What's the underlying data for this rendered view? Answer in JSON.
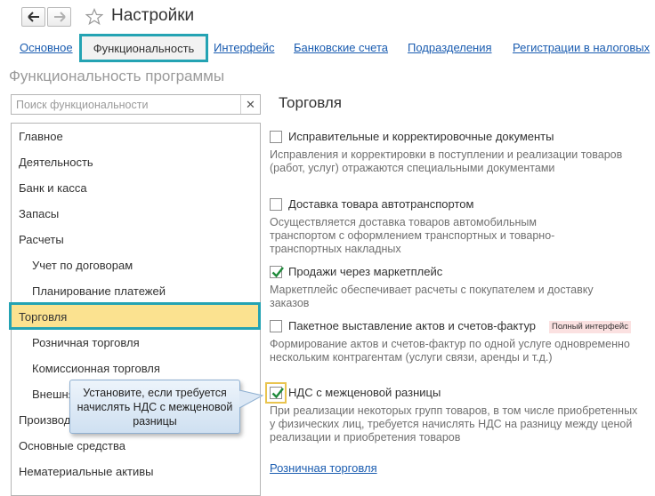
{
  "window": {
    "title": "Настройки"
  },
  "tabs": [
    {
      "label": "Основное"
    },
    {
      "label": "Функциональность",
      "active": true
    },
    {
      "label": "Интерфейс"
    },
    {
      "label": "Банковские счета"
    },
    {
      "label": "Подразделения"
    },
    {
      "label": "Регистрации в налоговых"
    }
  ],
  "section": {
    "title": "Функциональность программы"
  },
  "search": {
    "placeholder": "Поиск функциональности",
    "value": ""
  },
  "categories": [
    {
      "label": "Главное",
      "level": 0
    },
    {
      "label": "Деятельность",
      "level": 0
    },
    {
      "label": "Банк и касса",
      "level": 0
    },
    {
      "label": "Запасы",
      "level": 0
    },
    {
      "label": "Расчеты",
      "level": 0
    },
    {
      "label": "Учет по договорам",
      "level": 1
    },
    {
      "label": "Планирование платежей",
      "level": 1
    },
    {
      "label": "Торговля",
      "level": 0,
      "selected": true
    },
    {
      "label": "Розничная торговля",
      "level": 1
    },
    {
      "label": "Комиссионная торговля",
      "level": 1
    },
    {
      "label": "Внешняя торговля",
      "level": 1
    },
    {
      "label": "Производство",
      "level": 0
    },
    {
      "label": "Основные средства",
      "level": 0
    },
    {
      "label": "Нематериальные активы",
      "level": 0
    }
  ],
  "panel": {
    "title": "Торговля",
    "options": [
      {
        "label": "Исправительные и корректировочные документы",
        "checked": false,
        "description": "Исправления и корректировки в поступлении и реализации товаров (работ, услуг) отражаются специальными документами"
      },
      {
        "label": "Доставка товара автотранспортом",
        "checked": false,
        "description": "Осуществляется доставка товаров автомобильным транспортом с оформлением транспортных и товарно-транспортных накладных"
      },
      {
        "label": "Продажи через маркетплейс",
        "checked": true,
        "description": "Маркетплейс обеспечивает расчеты с покупателем и доставку заказов"
      },
      {
        "label": "Пакетное выставление актов и счетов-фактур",
        "checked": false,
        "badge": "Полный интерфейс",
        "description": "Формирование актов и счетов-фактур по одной услуге одновременно нескольким контрагентам (услуги связи, аренды и т.д.)"
      },
      {
        "label": "НДС с межценовой разницы",
        "checked": true,
        "highlighted": true,
        "description": "При реализации некоторых групп товаров, в том числе приобретенных у физических лиц, требуется начислять НДС на разницу между ценой реализации и приобретения товаров"
      }
    ],
    "link": "Розничная торговля"
  },
  "callout": {
    "text": "Установите, если требуется начислять НДС с межценовой разницы"
  },
  "colors": {
    "accent_frame": "#24a3b3",
    "selected_row": "#fbe290",
    "link": "#1a5cb0",
    "badge_bg": "#fbe1e1"
  },
  "icons": {
    "back": "arrow-left-icon",
    "forward": "arrow-right-icon",
    "favorite": "star-icon",
    "clear": "close-icon",
    "check": "checkmark-icon"
  }
}
